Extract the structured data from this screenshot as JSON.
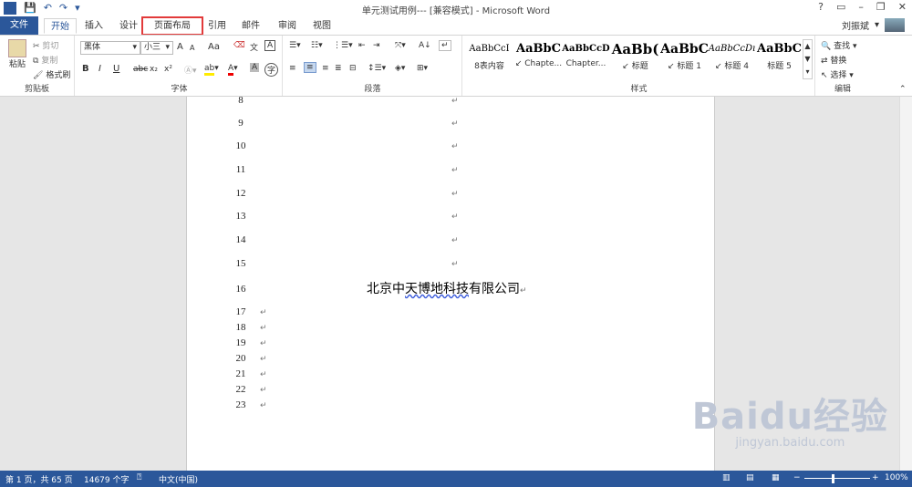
{
  "title_bar": {
    "title": "单元测试用例--- [兼容模式] - Microsoft Word",
    "app_icon": "W",
    "controls": [
      "?",
      "▭",
      "–",
      "❐",
      "✕"
    ]
  },
  "tabs": {
    "file": "文件",
    "items": [
      "开始",
      "插入",
      "设计",
      "页面布局",
      "引用",
      "邮件",
      "审阅",
      "视图"
    ],
    "active": "开始",
    "highlighted": "页面布局"
  },
  "user": {
    "name": "刘振斌"
  },
  "ribbon": {
    "clipboard": {
      "paste": "粘贴",
      "cut": "剪切",
      "copy": "复制",
      "format_painter": "格式刷",
      "label": "剪贴板"
    },
    "font": {
      "name": "黑体",
      "size": "小三",
      "label": "字体",
      "grow": "A",
      "shrink": "A",
      "case": "Aa",
      "bold": "B",
      "italic": "I",
      "underline": "U",
      "strike": "abc",
      "sub": "x₂",
      "sup": "x²"
    },
    "paragraph": {
      "label": "段落"
    },
    "styles": {
      "label": "样式",
      "items": [
        {
          "preview": "AaBbCcI",
          "name": "8表内容"
        },
        {
          "preview": "AaBbC",
          "name": "↙ Chapte..."
        },
        {
          "preview": "AaBbCcD",
          "name": "Chapter..."
        },
        {
          "preview": "AaBb(",
          "name": "↙ 标题"
        },
        {
          "preview": "AaBbC",
          "name": "↙ 标题 1"
        },
        {
          "preview": "AaBbCcDı",
          "name": "↙ 标题 4"
        },
        {
          "preview": "AaBbC",
          "name": "标题 5"
        }
      ]
    },
    "editing": {
      "label": "编辑",
      "find": "查找",
      "replace": "替换",
      "select": "选择"
    }
  },
  "document": {
    "line_numbers": [
      "8",
      "9",
      "10",
      "11",
      "12",
      "13",
      "14",
      "15",
      "16",
      "17",
      "18",
      "19",
      "20",
      "21",
      "22",
      "23"
    ],
    "company_pre": "北京中",
    "company_underlined": "天博地科技",
    "company_post": "有限公司"
  },
  "status": {
    "page": "第 1 页，共 65 页",
    "words": "14679 个字",
    "lang": "中文(中国)",
    "zoom": "100%"
  },
  "watermark": {
    "text": "Baidu经验",
    "url": "jingyan.baidu.com"
  }
}
